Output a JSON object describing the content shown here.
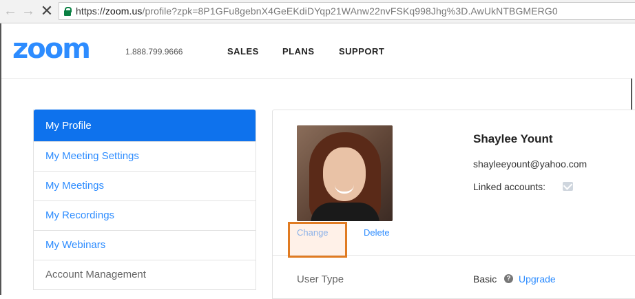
{
  "browser": {
    "back_icon": "back-arrow-icon",
    "forward_icon": "forward-arrow-icon",
    "stop_icon": "close-icon",
    "url_scheme": "https://",
    "url_host": "zoom.us",
    "url_path": "/profile?zpk=8P1GFu8gebnX4GeEKdiDYqp21WAnw22nvFSKq998Jhg%3D.AwUkNTBGMERG0",
    "lock_color": "#0b8043"
  },
  "header": {
    "logo": "zoom",
    "phone": "1.888.799.9666",
    "nav": [
      "SALES",
      "PLANS",
      "SUPPORT"
    ],
    "brand_color": "#2d8cff"
  },
  "sidebar": {
    "items": [
      {
        "label": "My Profile",
        "active": true
      },
      {
        "label": "My Meeting Settings"
      },
      {
        "label": "My Meetings"
      },
      {
        "label": "My Recordings"
      },
      {
        "label": "My Webinars"
      },
      {
        "label": "Account Management"
      }
    ],
    "active_color": "#0e72ed"
  },
  "profile": {
    "name": "Shaylee Yount",
    "email": "shayleeyount@yahoo.com",
    "linked_label": "Linked accounts:",
    "linked_icon": "email-icon",
    "change_label": "Change",
    "delete_label": "Delete",
    "user_type_label": "User Type",
    "user_type_value": "Basic",
    "help_icon": "question-icon",
    "upgrade_label": "Upgrade",
    "highlight_color": "#e07b22"
  }
}
